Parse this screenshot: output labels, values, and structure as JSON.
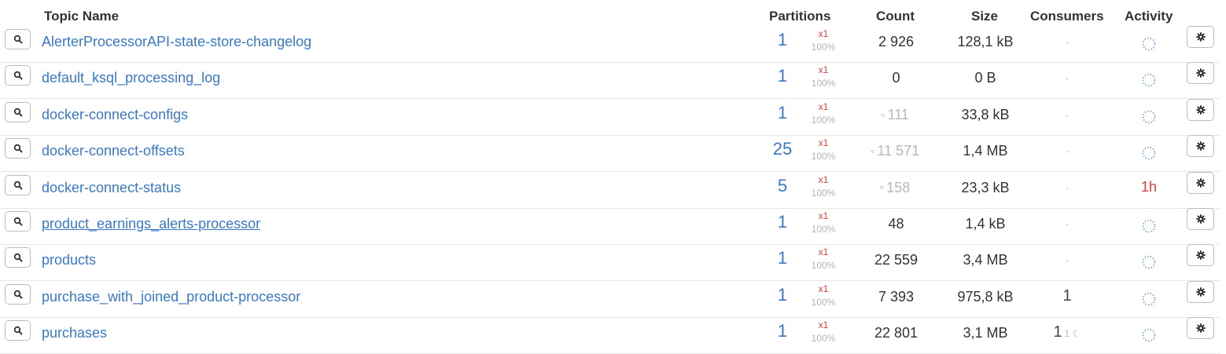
{
  "headers": {
    "topic_name": "Topic Name",
    "partitions": "Partitions",
    "count": "Count",
    "size": "Size",
    "consumers": "Consumers",
    "activity": "Activity"
  },
  "icons": {
    "search": "search-icon",
    "settings": "gear-icon",
    "activity": "loading-spinner-icon",
    "idle": "moon-icon"
  },
  "colors": {
    "link": "#3a78c6",
    "replication": "#e03c3c",
    "muted": "#b5b5b5"
  },
  "rows": [
    {
      "topic": "AlerterProcessorAPI-state-store-changelog",
      "partitions": "1",
      "replication": "x1",
      "percent": "100%",
      "count_prefix": "",
      "count": "2 926",
      "size": "128,1 kB",
      "consumers": "-",
      "consumers_extra": "",
      "activity": ""
    },
    {
      "topic": "default_ksql_processing_log",
      "partitions": "1",
      "replication": "x1",
      "percent": "100%",
      "count_prefix": "",
      "count": "0",
      "size": "0 B",
      "consumers": "-",
      "consumers_extra": "",
      "activity": ""
    },
    {
      "topic": "docker-connect-configs",
      "partitions": "1",
      "replication": "x1",
      "percent": "100%",
      "count_prefix": "≈",
      "count": "111",
      "size": "33,8 kB",
      "consumers": "-",
      "consumers_extra": "",
      "activity": ""
    },
    {
      "topic": "docker-connect-offsets",
      "partitions": "25",
      "replication": "x1",
      "percent": "100%",
      "count_prefix": "≈",
      "count": "11 571",
      "size": "1,4 MB",
      "consumers": "-",
      "consumers_extra": "",
      "activity": ""
    },
    {
      "topic": "docker-connect-status",
      "partitions": "5",
      "replication": "x1",
      "percent": "100%",
      "count_prefix": "≈",
      "count": "158",
      "size": "23,3 kB",
      "consumers": "-",
      "consumers_extra": "",
      "activity": "1h"
    },
    {
      "topic": "product_earnings_alerts-processor",
      "partitions": "1",
      "replication": "x1",
      "percent": "100%",
      "count_prefix": "",
      "count": "48",
      "size": "1,4 kB",
      "consumers": "-",
      "consumers_extra": "",
      "activity": ""
    },
    {
      "topic": "products",
      "partitions": "1",
      "replication": "x1",
      "percent": "100%",
      "count_prefix": "",
      "count": "22 559",
      "size": "3,4 MB",
      "consumers": "-",
      "consumers_extra": "",
      "activity": ""
    },
    {
      "topic": "purchase_with_joined_product-processor",
      "partitions": "1",
      "replication": "x1",
      "percent": "100%",
      "count_prefix": "",
      "count": "7 393",
      "size": "975,8 kB",
      "consumers": "1",
      "consumers_extra": "",
      "activity": ""
    },
    {
      "topic": "purchases",
      "partitions": "1",
      "replication": "x1",
      "percent": "100%",
      "count_prefix": "",
      "count": "22 801",
      "size": "3,1 MB",
      "consumers": "1",
      "consumers_extra": "1",
      "activity": ""
    }
  ]
}
